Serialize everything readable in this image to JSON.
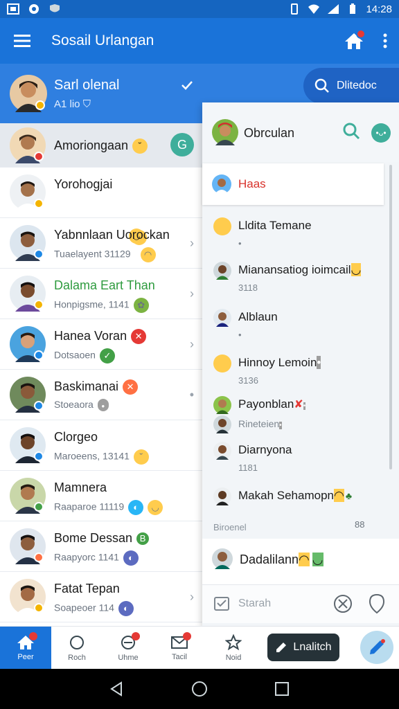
{
  "status": {
    "time": "14:28"
  },
  "appbar": {
    "title": "Sosail Urlangan"
  },
  "profile": {
    "name": "Sarl olenal",
    "sub": "A1 lio",
    "search_label": "Dlitedoc"
  },
  "contacts": [
    {
      "name": "Amoriongaan",
      "sub": ""
    },
    {
      "name": "Yorohogjai",
      "sub": ""
    },
    {
      "name": "Yabnnlaan Uorockan",
      "sub": "Tuaelayent 31129"
    },
    {
      "name": "Dalama Eart Than",
      "sub": "Honpigsme, 1141"
    },
    {
      "name": "Hanea Voran",
      "sub": "Dotsaoen"
    },
    {
      "name": "Baskimanai",
      "sub": "Stoeaora"
    },
    {
      "name": "Clorgeo",
      "sub": "Maroeens, 13141"
    },
    {
      "name": "Mamnera",
      "sub": "Raaparoe 11119"
    },
    {
      "name": "Bome Dessan",
      "sub": "Raapyorc 1141"
    },
    {
      "name": "Fatat Tepan",
      "sub": "Soapeoer 114"
    }
  ],
  "active_badge": "G",
  "panel": {
    "title": "Obrculan",
    "selected": "Haas",
    "items": [
      {
        "name": "Lldita Temane",
        "sub": "•"
      },
      {
        "name": "Mianansatiog ioimcail",
        "sub": "3118"
      },
      {
        "name": "Alblaun",
        "sub": "•"
      },
      {
        "name": "Hinnoy Lemoin",
        "sub": "3136"
      },
      {
        "name": "Payonblan",
        "sub": ""
      },
      {
        "name": "",
        "sub": "Rineteien"
      },
      {
        "name": "Diarnyona",
        "sub": "1181"
      },
      {
        "name": "Makah Sehamopn",
        "sub": ""
      }
    ],
    "footer_label": "Biroenel",
    "footer_num": "88",
    "bottom_contact": "Dadalilann",
    "input_placeholder": "Starah"
  },
  "bottom_nav": {
    "tabs": [
      {
        "label": "Peer",
        "icon": "home-icon"
      },
      {
        "label": "Roch",
        "icon": "circle-icon"
      },
      {
        "label": "Uhme",
        "icon": "compass-icon"
      },
      {
        "label": "Tacil",
        "icon": "mail-icon"
      },
      {
        "label": "Noid",
        "icon": "star-icon"
      }
    ],
    "action_label": "Lnalitch"
  },
  "colors": {
    "primary": "#1a73d9",
    "accent": "#3fae9b",
    "alert": "#e53935"
  }
}
